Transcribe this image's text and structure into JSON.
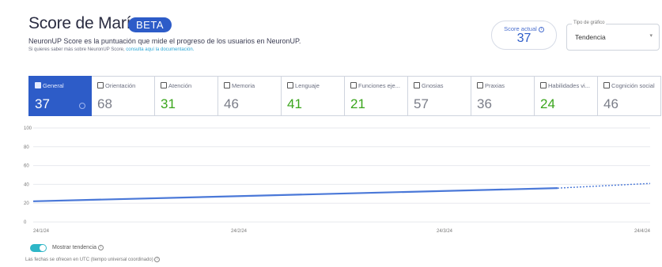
{
  "header": {
    "title": "Score de María",
    "badge": "BETA",
    "subtitle": "NeuronUP Score es la puntuación que mide el progreso de los usuarios en NeuronUP.",
    "doc_prefix": "Si quieres saber más sobre NeuronUP Score,",
    "doc_link": "consulta aquí la documentación."
  },
  "score": {
    "label": "Score actual",
    "value": "37"
  },
  "chart_type_select": {
    "legend": "Tipo de gráfico",
    "value": "Tendencia"
  },
  "tabs": [
    {
      "label": "General",
      "value": "37",
      "active": true
    },
    {
      "label": "Orientación",
      "value": "68"
    },
    {
      "label": "Atención",
      "value": "31",
      "green": true
    },
    {
      "label": "Memoria",
      "value": "46"
    },
    {
      "label": "Lenguaje",
      "value": "41",
      "green": true
    },
    {
      "label": "Funciones eje...",
      "value": "21",
      "green": true
    },
    {
      "label": "Gnosias",
      "value": "57"
    },
    {
      "label": "Praxias",
      "value": "36"
    },
    {
      "label": "Habilidades vi...",
      "value": "24",
      "green": true
    },
    {
      "label": "Cognición social",
      "value": "46"
    }
  ],
  "chart_data": {
    "type": "line",
    "y_ticks": [
      "0",
      "20",
      "40",
      "60",
      "80",
      "100"
    ],
    "ylim": [
      0,
      100
    ],
    "x_ticks": [
      "24/1/24",
      "24/2/24",
      "24/3/24",
      "24/4/24"
    ],
    "series": [
      {
        "values": [
          [
            0,
            22
          ],
          [
            2.55,
            36
          ]
        ],
        "style": "solid",
        "color": "#4a78d8"
      },
      {
        "values": [
          [
            2.55,
            36
          ],
          [
            3,
            41
          ]
        ],
        "style": "dashed",
        "color": "#4a78d8"
      }
    ]
  },
  "trend_toggle": {
    "label": "Mostrar tendencia",
    "on": true
  },
  "footer_note": "Las fechas se ofrecen en UTC (tiempo universal coordinado)"
}
